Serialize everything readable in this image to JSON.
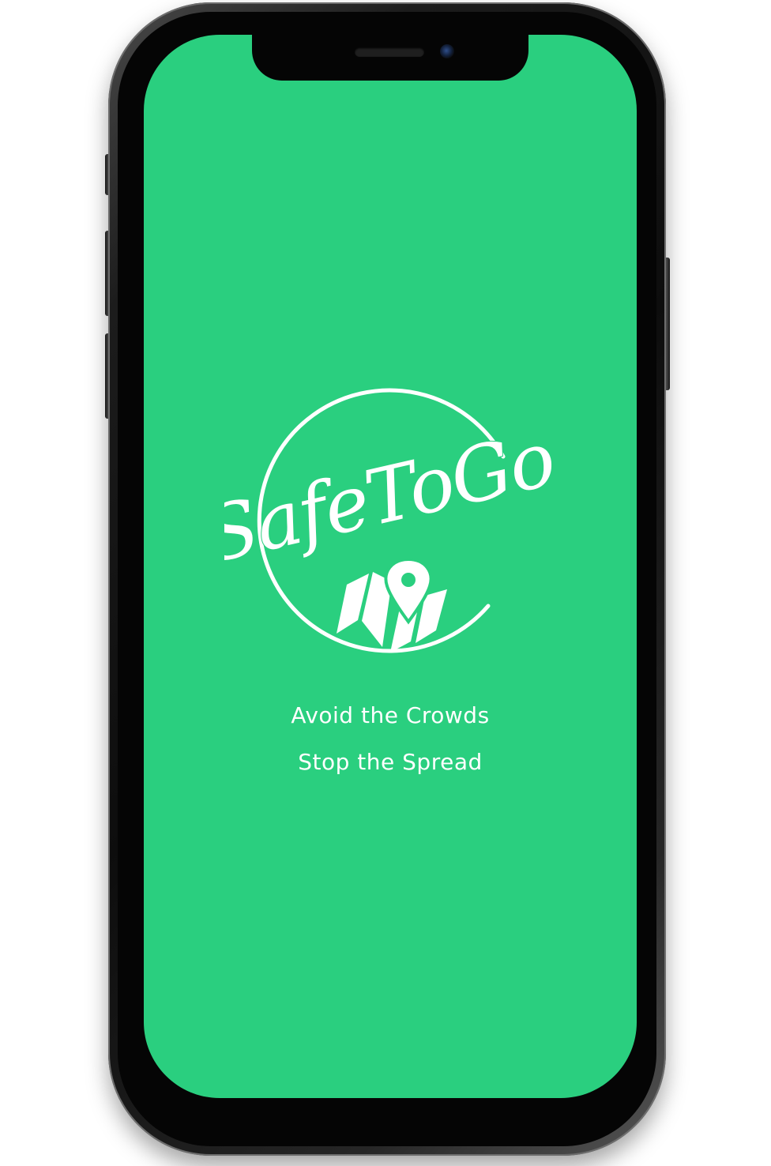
{
  "app": {
    "logo_text": "SafeToGo",
    "logo_icon": "map-pin-icon",
    "tagline_line1": "Avoid the Crowds",
    "tagline_line2": "Stop the Spread"
  },
  "colors": {
    "screen_background": "#2acf7f",
    "foreground": "#ffffff",
    "device_frame": "#111111"
  }
}
